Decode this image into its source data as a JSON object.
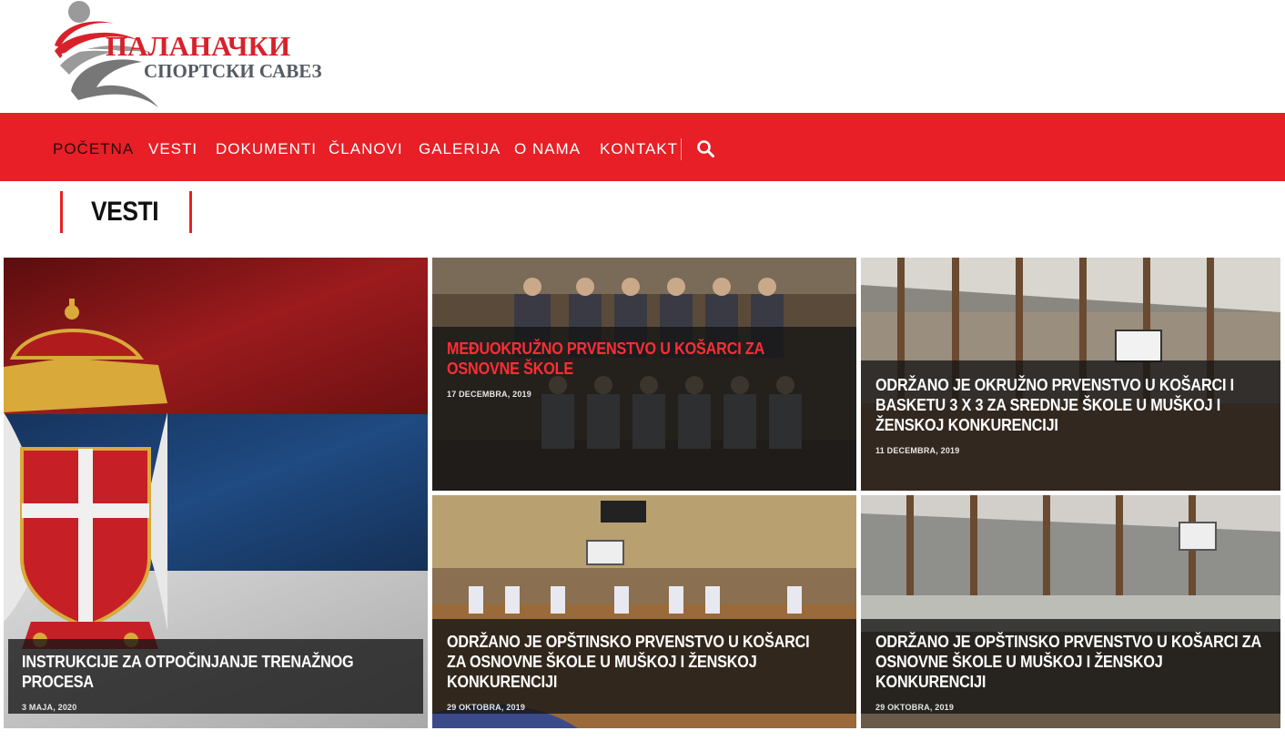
{
  "brand": {
    "name_line1": "ПАЛАНАЧКИ",
    "name_line2": "СПОРТСКИ САВЕЗ",
    "accent_color": "#e81f26"
  },
  "nav": {
    "items": [
      {
        "label": "POČETNA",
        "active": true
      },
      {
        "label": "VESTI",
        "active": false
      },
      {
        "label": "DOKUMENTI",
        "active": false
      },
      {
        "label": "ČLANOVI",
        "active": false
      },
      {
        "label": "GALERIJA",
        "active": false
      },
      {
        "label": "O NAMA",
        "active": false
      },
      {
        "label": "KONTAKT",
        "active": false
      }
    ],
    "search_icon": "search-icon"
  },
  "section": {
    "title": "VESTI"
  },
  "posts": [
    {
      "title": "INSTRUKCIJE ZA OTPOČINJANJE TRENAŽNOG PROCESA",
      "date": "3 MAJA, 2020",
      "image": "serbian-flag-coat-of-arms"
    },
    {
      "title": "MEĐUOKRUŽNO PRVENSTVO U KOŠARCI ZA OSNOVNE ŠKOLE",
      "date": "17 DECEMBRA, 2019",
      "image": "girls-basketball-team-photo"
    },
    {
      "title": "ODRŽANO JE OKRUŽNO PRVENSTVO U KOŠARCI I BASKETU 3 X 3 ZA SREDNJE ŠKOLE U MUŠKOJ I ŽENSKOJ KONKURENCIJI",
      "date": "11 DECEMBRA, 2019",
      "image": "sports-hall-interior"
    },
    {
      "title": "ODRŽANO JE OPŠTINSKO PRVENSTVO U KOŠARCI ZA OSNOVNE ŠKOLE U MUŠKOJ I ŽENSKOJ KONKURENCIJI",
      "date": "29 OKTOBRA, 2019",
      "image": "basketball-court-players"
    },
    {
      "title": "ODRŽANO JE OPŠTINSKO PRVENSTVO U KOŠARCI ZA OSNOVNE ŠKOLE U MUŠKOJ I ŽENSKOJ KONKURENCIJI",
      "date": "29 OKTOBRA, 2019",
      "image": "sports-hall-bleachers"
    }
  ]
}
